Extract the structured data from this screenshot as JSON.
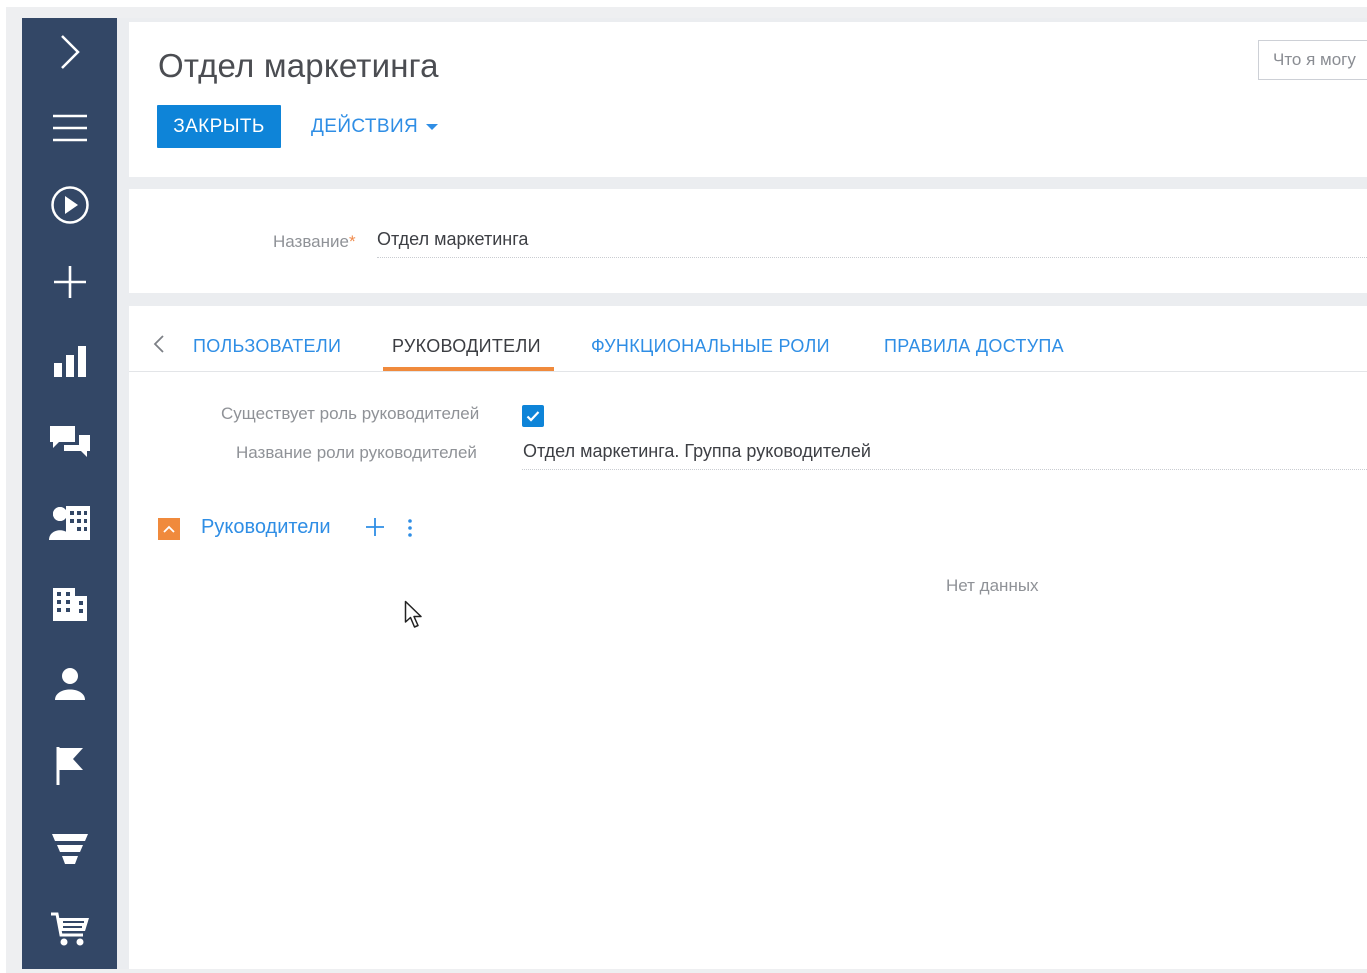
{
  "sidebar": {
    "items": [
      {
        "icon": "chevron-right-icon"
      },
      {
        "icon": "hamburger-menu-icon"
      },
      {
        "icon": "play-circle-icon"
      },
      {
        "icon": "plus-icon"
      },
      {
        "icon": "bar-chart-icon"
      },
      {
        "icon": "chat-bubbles-icon"
      },
      {
        "icon": "contacts-building-icon"
      },
      {
        "icon": "building-icon"
      },
      {
        "icon": "user-icon"
      },
      {
        "icon": "flag-icon"
      },
      {
        "icon": "funnel-icon"
      },
      {
        "icon": "cart-icon"
      }
    ],
    "color": "#334766"
  },
  "header": {
    "title": "Отдел маркетинга",
    "close_label": "ЗАКРЫТЬ",
    "actions_label": "ДЕЙСТВИЯ",
    "what_can_i_do": "Что я могу"
  },
  "fields": {
    "name_label": "Название",
    "name_required_mark": "*",
    "name_value": "Отдел маркетинга"
  },
  "tabs": [
    {
      "label": "ПОЛЬЗОВАТЕЛИ",
      "active": false
    },
    {
      "label": "РУКОВОДИТЕЛИ",
      "active": true
    },
    {
      "label": "ФУНКЦИОНАЛЬНЫЕ РОЛИ",
      "active": false
    },
    {
      "label": "ПРАВИЛА ДОСТУПА",
      "active": false
    }
  ],
  "managers_tab": {
    "role_exists_label": "Существует роль руководителей",
    "role_exists_checked": true,
    "role_name_label": "Название роли руководителей",
    "role_name_value": "Отдел маркетинга. Группа руководителей",
    "detail_title": "Руководители",
    "no_data": "Нет данных"
  },
  "colors": {
    "accent_blue": "#0e84d8",
    "link_blue": "#2f8ee5",
    "orange": "#f08a3c"
  }
}
